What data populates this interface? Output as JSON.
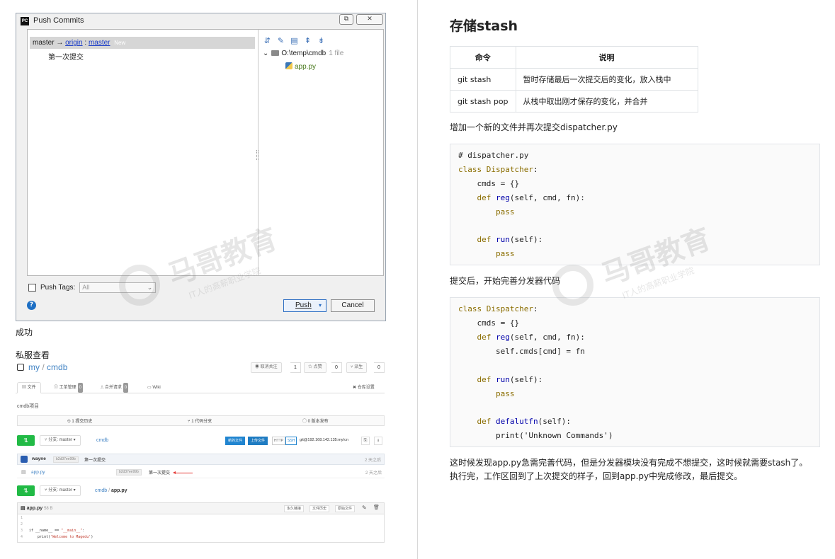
{
  "dialog": {
    "title": "Push Commits",
    "restore_btn": "⧉",
    "close_btn": "✕",
    "branch": {
      "local": "master",
      "arrow": "→",
      "remote": "origin",
      "colon": ":",
      "target": "master",
      "new_tag": "New"
    },
    "commit": "第一次提交",
    "files_toolbar": [
      "⇵",
      "✎",
      "▤",
      "⇞",
      "⇟"
    ],
    "repo_path": "O:\\temp\\cmdb",
    "file_count": "1 file",
    "file_name": "app.py",
    "push_tags_label": "Push Tags:",
    "tags_value": "All",
    "push_label": "Push",
    "cancel_label": "Cancel",
    "help": "?"
  },
  "left_text": {
    "success": "成功",
    "check_server": "私服查看"
  },
  "gitweb": {
    "owner": "my",
    "sep": "/",
    "repo": "cmdb",
    "watch_label": "◉ 取消关注",
    "watch_count": "1",
    "star_label": "☆ 点赞",
    "star_count": "0",
    "fork_label": "⑂ 派生",
    "fork_count": "0",
    "tabs": [
      {
        "label": "▤ 文件"
      },
      {
        "label": "ⓘ 工单管理",
        "badge": "0"
      },
      {
        "label": "⎍ 合并请求",
        "badge": "0"
      },
      {
        "label": "▭ Wiki"
      }
    ],
    "settings": "✖ 仓库设置",
    "description": "cmdb项目",
    "stats": {
      "commits": "⏲ 1 提交历史",
      "branches": "⑂ 1 代码分支",
      "releases": "⃝ 0 版本发布"
    },
    "btn_icon": "⇅",
    "branch_label": "⑂ 分支: master ▾",
    "crumb_repo": "cmdb",
    "new_file": "新的文件",
    "upload_file": "上传文件",
    "http": "HTTP",
    "ssh": "SSH",
    "clone_url": "git@192.168.142.135:my/cn",
    "copy_icon": "⎘",
    "download_icon": "⭳",
    "last_commit": {
      "user": "wayne",
      "sha": "b2d37ee99b",
      "message": "第一次提交",
      "ago": "2 天之后"
    },
    "file_row": {
      "icon": "▤",
      "name": "app.py",
      "sha": "b2d37ee99b",
      "message": "第一次提交",
      "ago": "2 天之后"
    },
    "crumb2_sep": "/",
    "crumb2_file": "app.py",
    "file_head": {
      "icon": "▤",
      "name": "app.py",
      "size": "58 B",
      "permalink": "永久链接",
      "history": "文件历史",
      "raw": "原始文件",
      "edit_icon": "✎",
      "delete_icon": "🗑"
    },
    "code_lines": [
      "1",
      "2",
      "3",
      "4"
    ],
    "code_line3_a": "if __name__ == ",
    "code_line3_str": "\"__main__\"",
    "code_line3_b": ":",
    "code_line4_a": "    print(",
    "code_line4_str": "'Welcome to Magedu'",
    "code_line4_b": ")"
  },
  "right": {
    "heading": "存储stash",
    "table": {
      "headers": [
        "命令",
        "说明"
      ],
      "rows": [
        [
          "git stash",
          "暂时存储最后一次提交后的变化，放入栈中"
        ],
        [
          "git stash pop",
          "从栈中取出刚才保存的变化，并合并"
        ]
      ]
    },
    "para1": "增加一个新的文件并再次提交dispatcher.py",
    "code1": {
      "line1": "# dispatcher.py",
      "kw_class": "class",
      "class_name": "Dispatcher",
      "colon": ":",
      "line3": "    cmds = {}",
      "kw_def": "def",
      "fn_reg": "reg",
      "reg_args": "(self, cmd, fn):",
      "kw_pass": "pass",
      "fn_run": "run",
      "run_args": "(self):"
    },
    "para2": "提交后，开始完善分发器代码",
    "code2": {
      "reg_body": "self.cmds[cmd] = fn",
      "fn_default": "defalutfn",
      "default_body": "print('Unknown Commands')"
    },
    "para3_l1": "这时候发现app.py急需完善代码，但是分发器模块没有完成不想提交，这时候就需要stash了。",
    "para3_l2": "执行完，工作区回到了上次提交的样子，回到app.py中完成修改，最后提交。"
  },
  "watermark": {
    "brand": "马哥教育",
    "slogan": "IT人的高薪职业学院"
  }
}
